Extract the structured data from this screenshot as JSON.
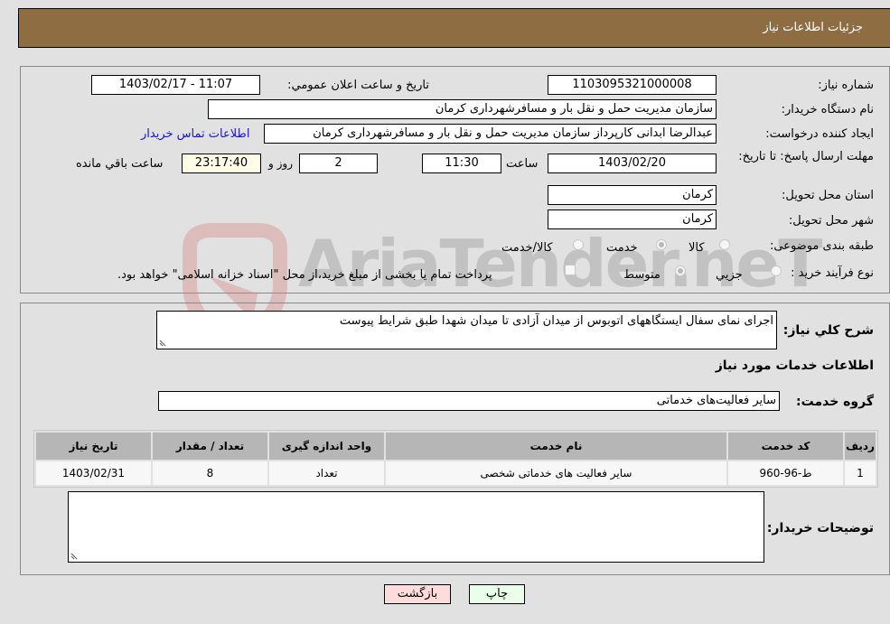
{
  "header": {
    "title": "جزئیات اطلاعات نیاز"
  },
  "form": {
    "need_number": {
      "label": "شماره نیاز:",
      "value": "1103095321000008"
    },
    "announce_datetime": {
      "label": "تاريخ و ساعت اعلان عمومي:",
      "value": "1403/02/17 - 11:07"
    },
    "buyer_org": {
      "label": "نام دستگاه خريدار:",
      "value": "سازمان مدیریت حمل و نقل بار و مسافرشهرداری کرمان"
    },
    "requester": {
      "label": "ايجاد کننده درخواست:",
      "value": "عبدالرضا ابدانی کارپرداز سازمان مدیریت حمل و نقل بار و مسافرشهرداری کرمان"
    },
    "buyer_contact_link": "اطلاعات تماس خريدار",
    "deadline": {
      "label": "مهلت ارسال پاسخ: تا تاريخ:",
      "date": "1403/02/20",
      "time_label": "ساعت",
      "time": "11:30",
      "days": "2",
      "days_label": "روز و",
      "remaining": "23:17:40",
      "remaining_label": "ساعت باقي مانده"
    },
    "province": {
      "label": "استان محل تحويل:",
      "value": "کرمان"
    },
    "city": {
      "label": "شهر محل تحويل:",
      "value": "کرمان"
    },
    "category": {
      "label": "طبقه بندی موضوعی:",
      "options": [
        "کالا",
        "خدمت",
        "کالا/خدمت"
      ],
      "selected": "خدمت"
    },
    "process_type": {
      "label": "نوع فرآيند خريد :",
      "options": [
        "جزيي",
        "متوسط"
      ],
      "selected": "متوسط",
      "checkbox_label": "پرداخت تمام يا بخشی از مبلغ خريد،از محل \"اسناد خزانه اسلامی\" خواهد بود."
    }
  },
  "details": {
    "description_label": "شرح کلي نياز:",
    "description_value": "اجرای نمای سفال ایستگاههای اتوبوس از میدان آزادی تا میدان شهدا طبق شرایط پیوست",
    "services_heading": "اطلاعات خدمات مورد نياز",
    "service_group_label": "گروه خدمت:",
    "service_group_value": "سایر فعالیت‌های خدماتی",
    "table": {
      "headers": [
        "رديف",
        "کد خدمت",
        "نام خدمت",
        "واحد اندازه گيری",
        "تعداد / مقدار",
        "تاريخ نياز"
      ],
      "rows": [
        [
          "1",
          "ط-96-960",
          "سایر فعالیت های خدماتی شخصی",
          "تعداد",
          "8",
          "1403/02/31"
        ]
      ]
    },
    "buyer_notes_label": "توضيحات خريدار:",
    "buyer_notes_value": ""
  },
  "buttons": {
    "print": "چاپ",
    "back": "بازگشت"
  },
  "watermark": {
    "text": "AriaTender.neT"
  }
}
